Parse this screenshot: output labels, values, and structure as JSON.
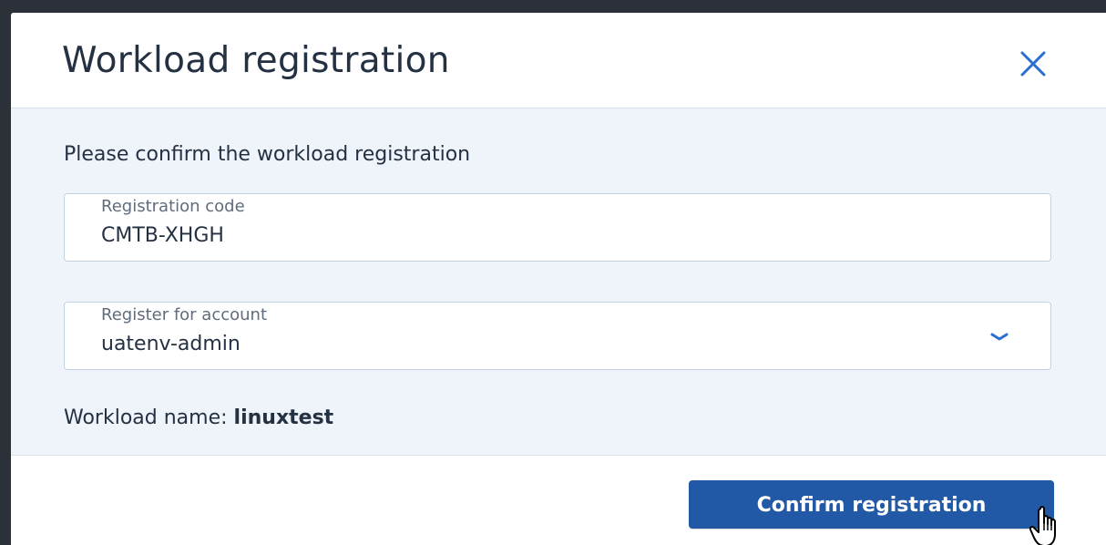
{
  "dialog": {
    "title": "Workload registration",
    "close_icon": "close-icon",
    "accent_color": "#2159a6"
  },
  "body": {
    "intro": "Please confirm the workload registration",
    "registration_code": {
      "label": "Registration code",
      "value": "CMTB-XHGH"
    },
    "account": {
      "label": "Register for account",
      "value": "uatenv-admin",
      "icon": "chevron-down-icon"
    },
    "workload": {
      "label": "Workload name:",
      "value": "linuxtest"
    }
  },
  "footer": {
    "confirm_label": "Confirm registration"
  }
}
